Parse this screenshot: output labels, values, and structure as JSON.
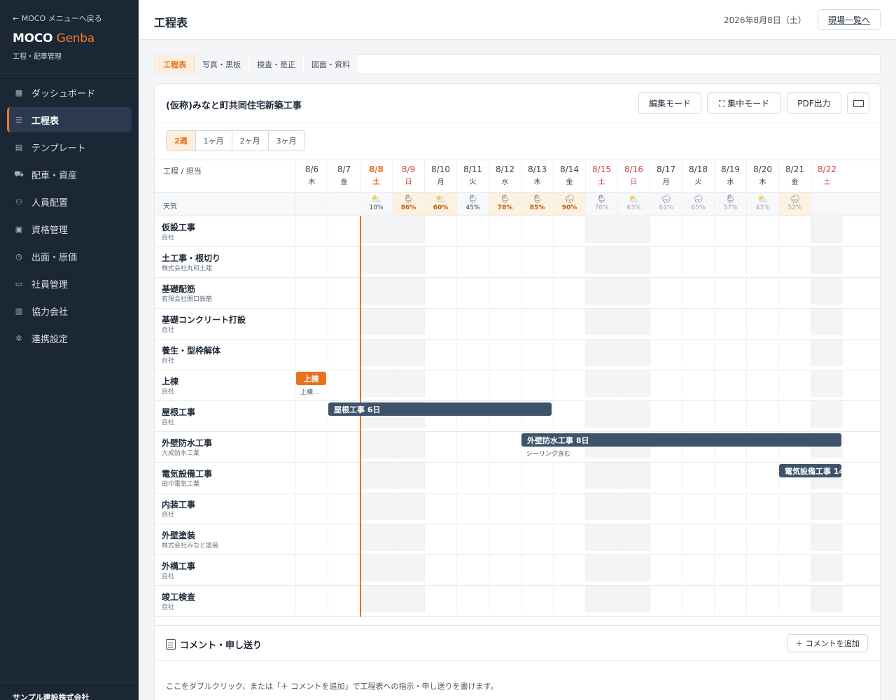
{
  "sidebar": {
    "back_link": "← MOCO メニューへ戻る",
    "brand_main": "MOCO",
    "brand_accent": "Genba",
    "brand_sub": "工程・配車管理",
    "items": [
      {
        "label": "ダッシュボード",
        "icon": "grid-icon"
      },
      {
        "label": "工程表",
        "icon": "list-icon",
        "active": true
      },
      {
        "label": "テンプレート",
        "icon": "document-icon"
      },
      {
        "label": "配車・資産",
        "icon": "truck-icon"
      },
      {
        "label": "人員配置",
        "icon": "users-icon"
      },
      {
        "label": "資格管理",
        "icon": "clipboard-icon"
      },
      {
        "label": "出面・原価",
        "icon": "clock-icon"
      },
      {
        "label": "社員管理",
        "icon": "id-card-icon"
      },
      {
        "label": "協力会社",
        "icon": "building-icon"
      },
      {
        "label": "連携設定",
        "icon": "gear-icon"
      }
    ],
    "company": "サンプル建設株式会社"
  },
  "header": {
    "title": "工程表",
    "date": "2026年8月8日（土）",
    "site_list_button": "現場一覧へ"
  },
  "tabs": [
    "工程表",
    "写真・黒板",
    "検査・是正",
    "図面・資料"
  ],
  "project": {
    "name": "(仮称)みなと町共同住宅新築工事",
    "edit_mode": "編集モード",
    "focus_mode": "⛶ 集中モード",
    "pdf": "PDF出力"
  },
  "ranges": [
    "2週",
    "1ヶ月",
    "2ヶ月",
    "3ヶ月"
  ],
  "gantt": {
    "header_label": "工程 / 担当",
    "weather_label": "天気",
    "days": [
      {
        "date": "8/6",
        "wd": "木"
      },
      {
        "date": "8/7",
        "wd": "金"
      },
      {
        "date": "8/8",
        "wd": "土"
      },
      {
        "date": "8/9",
        "wd": "日"
      },
      {
        "date": "8/10",
        "wd": "月"
      },
      {
        "date": "8/11",
        "wd": "火"
      },
      {
        "date": "8/12",
        "wd": "水"
      },
      {
        "date": "8/13",
        "wd": "木"
      },
      {
        "date": "8/14",
        "wd": "金"
      },
      {
        "date": "8/15",
        "wd": "土"
      },
      {
        "date": "8/16",
        "wd": "日"
      },
      {
        "date": "8/17",
        "wd": "月"
      },
      {
        "date": "8/18",
        "wd": "火"
      },
      {
        "date": "8/19",
        "wd": "水"
      },
      {
        "date": "8/20",
        "wd": "木"
      },
      {
        "date": "8/21",
        "wd": "金"
      },
      {
        "date": "8/22",
        "wd": "土"
      }
    ],
    "weather": [
      {
        "icon": "",
        "pct": ""
      },
      {
        "icon": "",
        "pct": ""
      },
      {
        "icon": "⛅",
        "pct": "10%"
      },
      {
        "icon": "🌦",
        "pct": "86%"
      },
      {
        "icon": "⛅",
        "pct": "60%"
      },
      {
        "icon": "🌦",
        "pct": "45%"
      },
      {
        "icon": "🌦",
        "pct": "78%"
      },
      {
        "icon": "🌦",
        "pct": "85%"
      },
      {
        "icon": "🌧",
        "pct": "90%"
      },
      {
        "icon": "🌦",
        "pct": "76%"
      },
      {
        "icon": "⛅",
        "pct": "63%"
      },
      {
        "icon": "🌧",
        "pct": "61%"
      },
      {
        "icon": "🌧",
        "pct": "65%"
      },
      {
        "icon": "🌦",
        "pct": "57%"
      },
      {
        "icon": "⛅",
        "pct": "43%"
      },
      {
        "icon": "🌧",
        "pct": "52%"
      },
      {
        "icon": "",
        "pct": ""
      }
    ],
    "rows": [
      {
        "name": "仮設工事",
        "owner": "自社"
      },
      {
        "name": "土工事・根切り",
        "owner": "株式会社丸和土建"
      },
      {
        "name": "基礎配筋",
        "owner": "有限会社関口鉄筋"
      },
      {
        "name": "基礎コンクリート打設",
        "owner": "自社"
      },
      {
        "name": "養生・型枠解体",
        "owner": "自社"
      },
      {
        "name": "上棟",
        "owner": "自社"
      },
      {
        "name": "屋根工事",
        "owner": "自社"
      },
      {
        "name": "外壁防水工事",
        "owner": "大成防水工業"
      },
      {
        "name": "電気設備工事",
        "owner": "田中電気工業"
      },
      {
        "name": "内装工事",
        "owner": "自社"
      },
      {
        "name": "外壁塗装",
        "owner": "株式会社みなと塗装"
      },
      {
        "name": "外構工事",
        "owner": "自社"
      },
      {
        "name": "竣工検査",
        "owner": "自社"
      }
    ],
    "bars": {
      "jotou_label": "上棟",
      "jotou_note": "上棟…",
      "roof_label": "屋根工事 6日",
      "waterproof_label": "外壁防水工事 8日",
      "waterproof_note": "シーリング含む",
      "electric_label": "電気設備工事 14"
    }
  },
  "comments": {
    "title": "コメント・申し送り",
    "add_button": "＋ コメントを追加",
    "hint": "ここをダブルクリック、または「＋ コメントを追加」で工程表への指示・申し送りを書けます。"
  }
}
